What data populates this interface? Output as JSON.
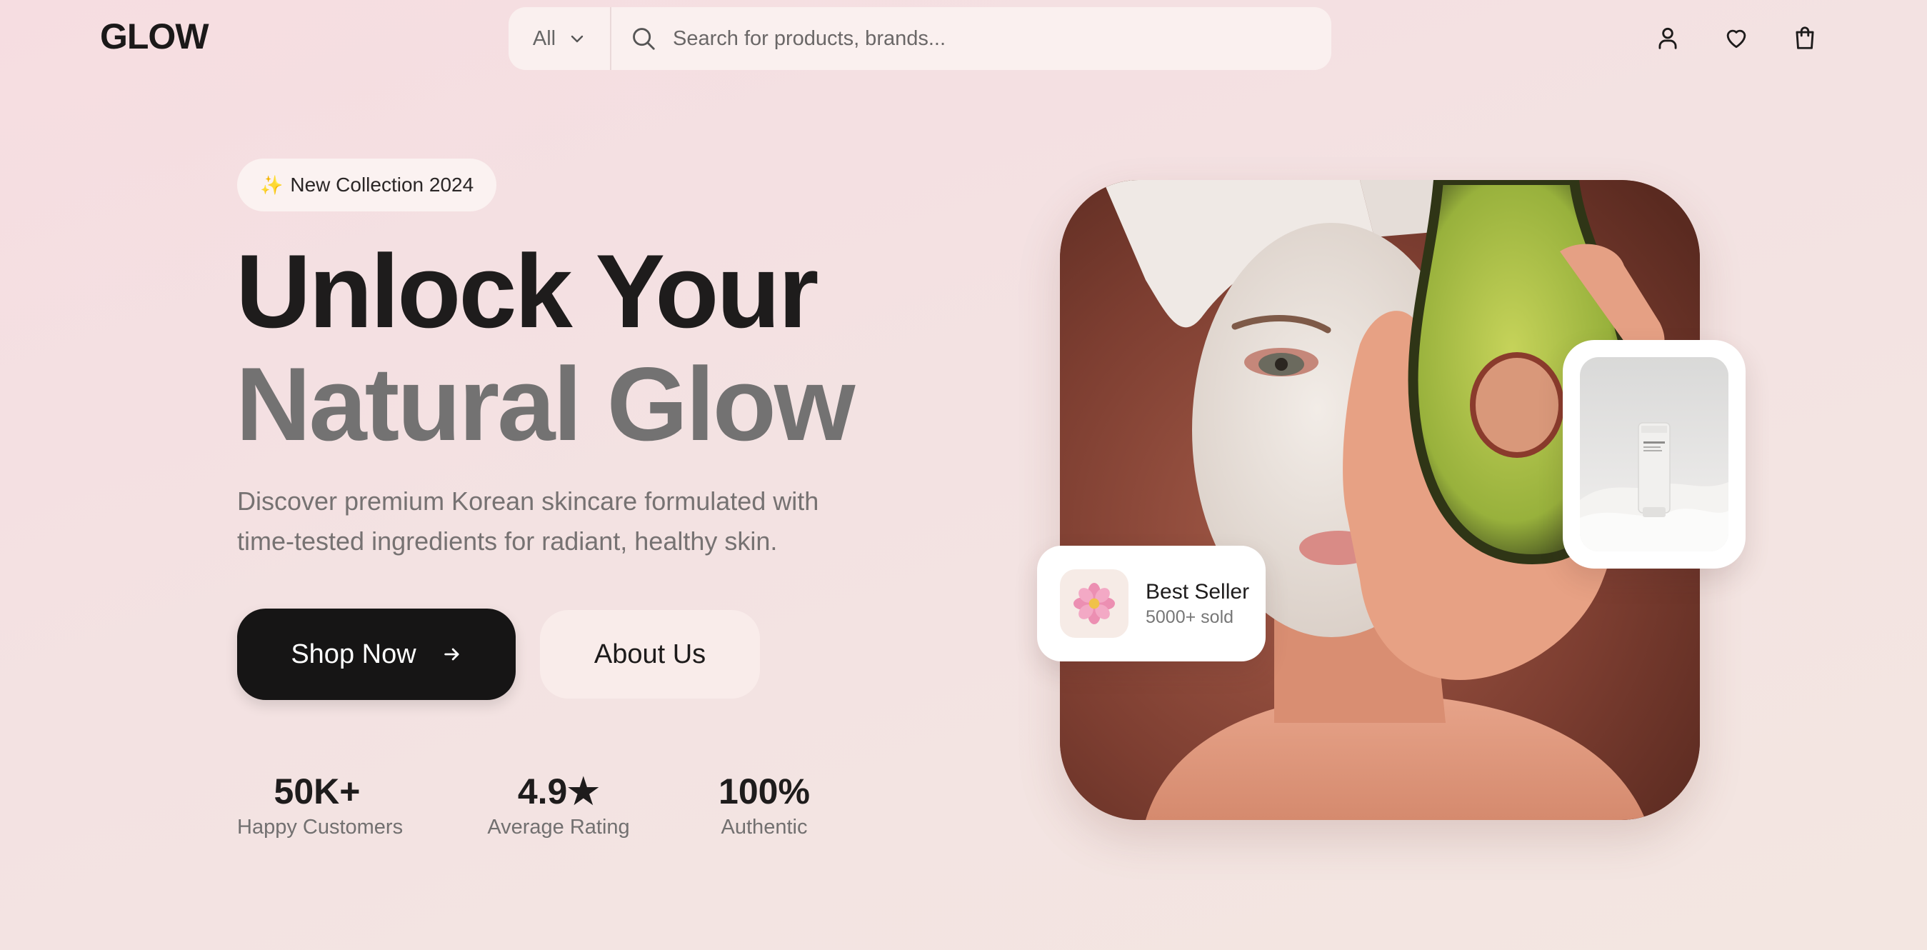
{
  "brand": {
    "logo": "GLOW"
  },
  "search": {
    "category": "All",
    "placeholder": "Search for products, brands..."
  },
  "header_icons": [
    "user-icon",
    "heart-icon",
    "shopping-bag-icon"
  ],
  "hero": {
    "badge": "New Collection 2024",
    "badge_icon": "sparkle-icon",
    "headline_line1": "Unlock Your",
    "headline_line2": "Natural Glow",
    "description": "Discover premium Korean skincare formulated with time-tested ingredients for radiant, healthy skin.",
    "primary_button": "Shop Now",
    "secondary_button": "About Us"
  },
  "stats": [
    {
      "value": "50K+",
      "label": "Happy Customers"
    },
    {
      "value": "4.9★",
      "label": "Average Rating"
    },
    {
      "value": "100%",
      "label": "Authentic"
    }
  ],
  "floating": {
    "best_seller_title": "Best Seller",
    "best_seller_sub": "5000+ sold",
    "best_seller_icon": "flower-icon"
  },
  "colors": {
    "background": "#f5dfe2",
    "text_dark": "#1e1c1c",
    "text_muted": "#737272",
    "button_dark": "#161515",
    "button_light": "#f9ecea"
  }
}
